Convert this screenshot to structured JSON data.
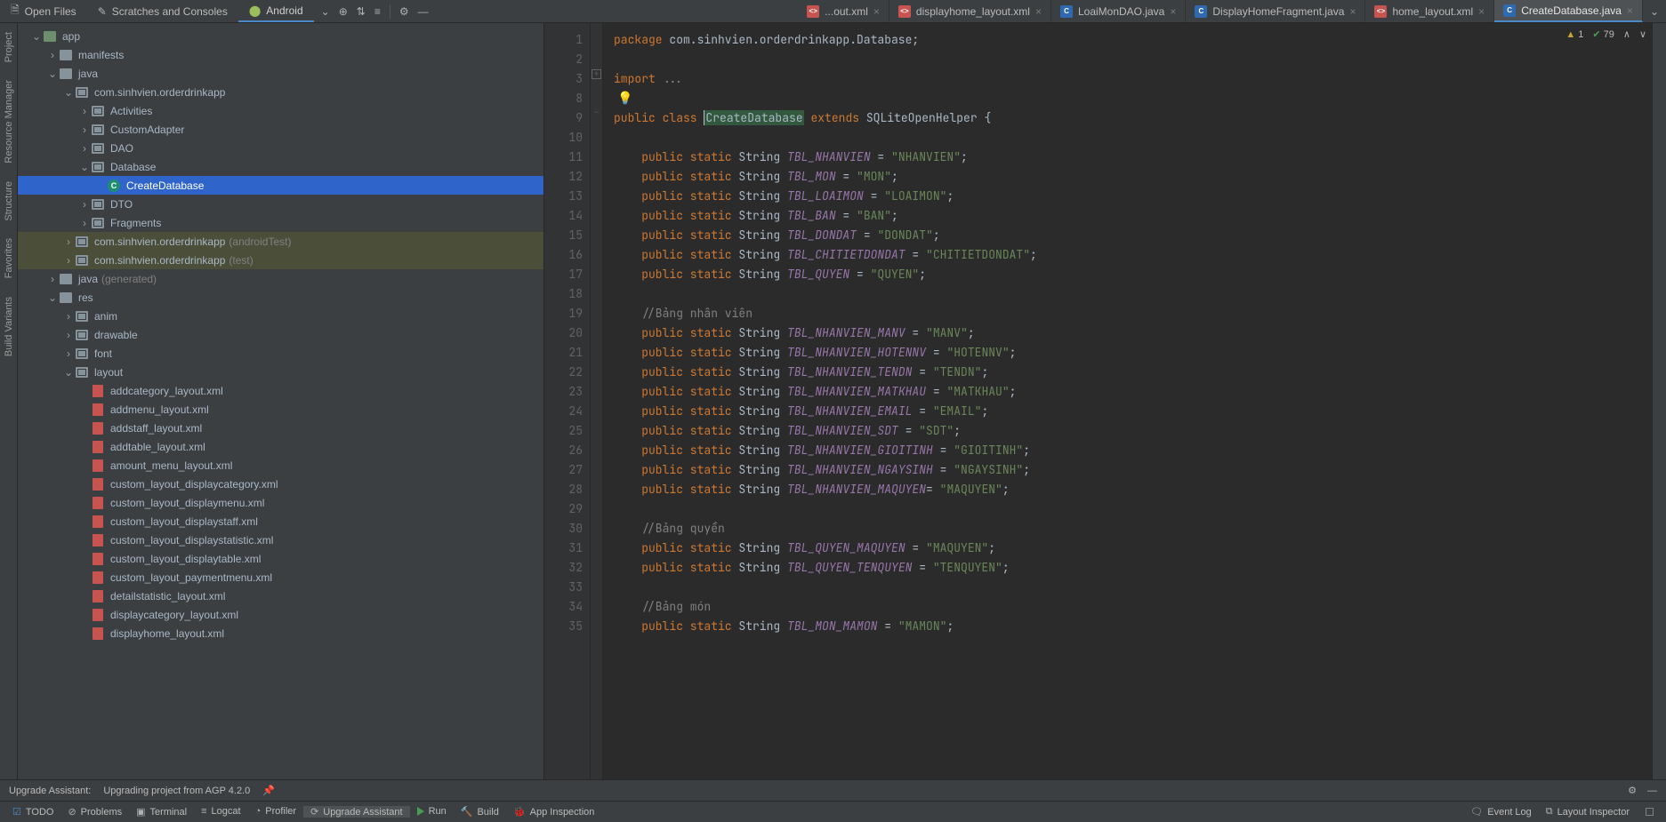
{
  "top_tabs": {
    "project_tabs": [
      {
        "label": "Open Files",
        "icon": "doc"
      },
      {
        "label": "Scratches and Consoles",
        "icon": "scratch"
      },
      {
        "label": "Android",
        "icon": "android",
        "active": true
      }
    ],
    "editor_tabs": [
      {
        "label": "...out.xml",
        "kind": "xml"
      },
      {
        "label": "displayhome_layout.xml",
        "kind": "xml"
      },
      {
        "label": "LoaiMonDAO.java",
        "kind": "java"
      },
      {
        "label": "DisplayHomeFragment.java",
        "kind": "java"
      },
      {
        "label": "home_layout.xml",
        "kind": "xml"
      },
      {
        "label": "CreateDatabase.java",
        "kind": "java",
        "active": true
      }
    ]
  },
  "left_strip": {
    "items": [
      "Project",
      "Resource Manager",
      "Structure",
      "Favorites",
      "Build Variants"
    ]
  },
  "tree": {
    "root": "app",
    "nodes": [
      {
        "d": 0,
        "arrow": "down",
        "icon": "module",
        "label": "app"
      },
      {
        "d": 1,
        "arrow": "right",
        "icon": "folder",
        "label": "manifests"
      },
      {
        "d": 1,
        "arrow": "down",
        "icon": "folder",
        "label": "java"
      },
      {
        "d": 2,
        "arrow": "down",
        "icon": "pkg",
        "label": "com.sinhvien.orderdrinkapp"
      },
      {
        "d": 3,
        "arrow": "right",
        "icon": "pkg",
        "label": "Activities"
      },
      {
        "d": 3,
        "arrow": "right",
        "icon": "pkg",
        "label": "CustomAdapter"
      },
      {
        "d": 3,
        "arrow": "right",
        "icon": "pkg",
        "label": "DAO"
      },
      {
        "d": 3,
        "arrow": "down",
        "icon": "pkg",
        "label": "Database"
      },
      {
        "d": 4,
        "arrow": "none",
        "icon": "class",
        "label": "CreateDatabase",
        "sel": true
      },
      {
        "d": 3,
        "arrow": "right",
        "icon": "pkg",
        "label": "DTO"
      },
      {
        "d": 3,
        "arrow": "right",
        "icon": "pkg",
        "label": "Fragments"
      },
      {
        "d": 2,
        "arrow": "right",
        "icon": "pkg",
        "label": "com.sinhvien.orderdrinkapp",
        "dim": "(androidTest)",
        "hl": true
      },
      {
        "d": 2,
        "arrow": "right",
        "icon": "pkg",
        "label": "com.sinhvien.orderdrinkapp",
        "dim": "(test)",
        "hl": true
      },
      {
        "d": 1,
        "arrow": "right",
        "icon": "genfolder",
        "label": "java",
        "dim": "(generated)"
      },
      {
        "d": 1,
        "arrow": "down",
        "icon": "resfolder",
        "label": "res"
      },
      {
        "d": 2,
        "arrow": "right",
        "icon": "pkg",
        "label": "anim"
      },
      {
        "d": 2,
        "arrow": "right",
        "icon": "pkg",
        "label": "drawable"
      },
      {
        "d": 2,
        "arrow": "right",
        "icon": "pkg",
        "label": "font"
      },
      {
        "d": 2,
        "arrow": "down",
        "icon": "pkg",
        "label": "layout"
      },
      {
        "d": 3,
        "arrow": "none",
        "icon": "xml",
        "label": "addcategory_layout.xml"
      },
      {
        "d": 3,
        "arrow": "none",
        "icon": "xml",
        "label": "addmenu_layout.xml"
      },
      {
        "d": 3,
        "arrow": "none",
        "icon": "xml",
        "label": "addstaff_layout.xml"
      },
      {
        "d": 3,
        "arrow": "none",
        "icon": "xml",
        "label": "addtable_layout.xml"
      },
      {
        "d": 3,
        "arrow": "none",
        "icon": "xml",
        "label": "amount_menu_layout.xml"
      },
      {
        "d": 3,
        "arrow": "none",
        "icon": "xml",
        "label": "custom_layout_displaycategory.xml"
      },
      {
        "d": 3,
        "arrow": "none",
        "icon": "xml",
        "label": "custom_layout_displaymenu.xml"
      },
      {
        "d": 3,
        "arrow": "none",
        "icon": "xml",
        "label": "custom_layout_displaystaff.xml"
      },
      {
        "d": 3,
        "arrow": "none",
        "icon": "xml",
        "label": "custom_layout_displaystatistic.xml"
      },
      {
        "d": 3,
        "arrow": "none",
        "icon": "xml",
        "label": "custom_layout_displaytable.xml"
      },
      {
        "d": 3,
        "arrow": "none",
        "icon": "xml",
        "label": "custom_layout_paymentmenu.xml"
      },
      {
        "d": 3,
        "arrow": "none",
        "icon": "xml",
        "label": "detailstatistic_layout.xml"
      },
      {
        "d": 3,
        "arrow": "none",
        "icon": "xml",
        "label": "displaycategory_layout.xml"
      },
      {
        "d": 3,
        "arrow": "none",
        "icon": "xml",
        "label": "displayhome_layout.xml"
      }
    ]
  },
  "editor": {
    "inspection": {
      "warnings": "1",
      "weak": "79"
    },
    "line_numbers": [
      "1",
      "2",
      "3",
      "8",
      "9",
      "10",
      "11",
      "12",
      "13",
      "14",
      "15",
      "16",
      "17",
      "18",
      "19",
      "20",
      "21",
      "22",
      "23",
      "24",
      "25",
      "26",
      "27",
      "28",
      "29",
      "30",
      "31",
      "32",
      "33",
      "34",
      "35",
      " "
    ],
    "code": {
      "pkg": "package com.sinhvien.orderdrinkapp.Database;",
      "imp": "import ...",
      "decl_pre": "public class ",
      "decl_name": "CreateDatabase",
      "decl_ext": " extends ",
      "decl_sup": "SQLiteOpenHelper {",
      "tbl": [
        {
          "f": "TBL_NHANVIEN",
          "v": "\"NHANVIEN\""
        },
        {
          "f": "TBL_MON",
          "v": "\"MON\""
        },
        {
          "f": "TBL_LOAIMON",
          "v": "\"LOAIMON\""
        },
        {
          "f": "TBL_BAN",
          "v": "\"BAN\""
        },
        {
          "f": "TBL_DONDAT",
          "v": "\"DONDAT\""
        },
        {
          "f": "TBL_CHITIETDONDAT",
          "v": "\"CHITIETDONDAT\""
        },
        {
          "f": "TBL_QUYEN",
          "v": "\"QUYEN\""
        }
      ],
      "cmt1": "//Bảng nhân viên",
      "nv": [
        {
          "f": "TBL_NHANVIEN_MANV",
          "v": "\"MANV\""
        },
        {
          "f": "TBL_NHANVIEN_HOTENNV",
          "v": "\"HOTENNV\""
        },
        {
          "f": "TBL_NHANVIEN_TENDN",
          "v": "\"TENDN\""
        },
        {
          "f": "TBL_NHANVIEN_MATKHAU",
          "v": "\"MATKHAU\""
        },
        {
          "f": "TBL_NHANVIEN_EMAIL",
          "v": "\"EMAIL\""
        },
        {
          "f": "TBL_NHANVIEN_SDT",
          "v": "\"SDT\""
        },
        {
          "f": "TBL_NHANVIEN_GIOITINH",
          "v": "\"GIOITINH\""
        },
        {
          "f": "TBL_NHANVIEN_NGAYSINH",
          "v": "\"NGAYSINH\""
        },
        {
          "f": "TBL_NHANVIEN_MAQUYEN",
          "eq": "= ",
          "v": "\"MAQUYEN\""
        }
      ],
      "cmt2": "//Bảng quyền",
      "q": [
        {
          "f": "TBL_QUYEN_MAQUYEN",
          "v": "\"MAQUYEN\""
        },
        {
          "f": "TBL_QUYEN_TENQUYEN",
          "v": "\"TENQUYEN\""
        }
      ],
      "cmt3": "//Bảng món",
      "m": [
        {
          "f": "TBL_MON_MAMON",
          "v": "\"MAMON\""
        }
      ]
    }
  },
  "upgrade": {
    "label": "Upgrade Assistant:",
    "msg": "Upgrading project from AGP 4.2.0"
  },
  "bottom": {
    "tools": [
      {
        "label": "TODO",
        "icon": "todo"
      },
      {
        "label": "Problems",
        "icon": "prob"
      },
      {
        "label": "Terminal",
        "icon": "term"
      },
      {
        "label": "Logcat",
        "icon": "logcat"
      },
      {
        "label": "Profiler",
        "icon": "prof"
      },
      {
        "label": "Upgrade Assistant",
        "icon": "upg",
        "sel": true
      },
      {
        "label": "Run",
        "icon": "run"
      },
      {
        "label": "Build",
        "icon": "build"
      },
      {
        "label": "App Inspection",
        "icon": "app"
      }
    ],
    "right": [
      {
        "label": "Event Log",
        "icon": "log"
      },
      {
        "label": "Layout Inspector",
        "icon": "layout"
      }
    ]
  }
}
